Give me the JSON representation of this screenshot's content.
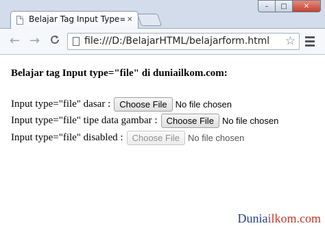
{
  "window": {
    "tab_title": "Belajar Tag Input Type=file",
    "tab_close": "×",
    "controls": {
      "minimize": "–",
      "maximize": "□",
      "close": "✕"
    }
  },
  "toolbar": {
    "back_icon": "←",
    "forward_icon": "→",
    "reload_icon": "C",
    "url": "file:///D:/BelajarHTML/belajarform.html",
    "star_icon": "☆"
  },
  "page": {
    "heading": "Belajar tag Input type=\"file\" di duniailkom.com:",
    "rows": [
      {
        "label": "Input type=\"file\" dasar :",
        "button": "Choose File",
        "status": "No file chosen"
      },
      {
        "label": "Input type=\"file\" tipe data gambar :",
        "button": "Choose File",
        "status": "No file chosen"
      },
      {
        "label": "Input type=\"file\" disabled :",
        "button": "Choose File",
        "status": "No file chosen"
      }
    ]
  },
  "watermark": {
    "part1": "Dunia",
    "part2": "ilkom.com"
  },
  "colors": {
    "frame": "#d2dcea",
    "watermark_blue": "#1f3f8f",
    "watermark_red": "#c0392b"
  }
}
